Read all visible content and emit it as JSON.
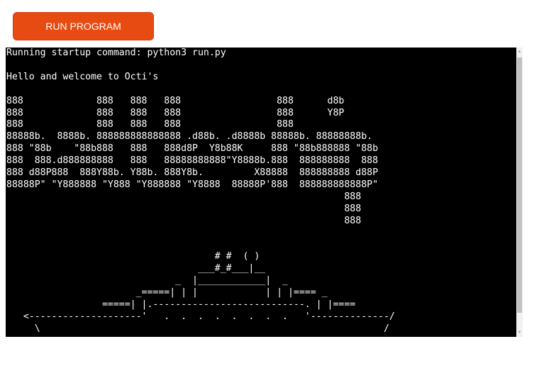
{
  "toolbar": {
    "run_label": "RUN PROGRAM",
    "accent_color": "#e84b12"
  },
  "terminal": {
    "lines": [
      "Running startup command: python3 run.py",
      "",
      "Hello and welcome to Octi's",
      "",
      "888             888   888   888                 888      d8b",
      "888             888   888   888                 888      Y8P",
      "888             888   888   888                 888",
      "88888b.  8888b. 888888888888888 .d88b. .d8888b 88888b. 88888888b.",
      "888 \"88b    \"88b888   888   888d8P  Y8b88K     888 \"88b888888 \"88b",
      "888  888.d888888888   888   88888888888\"Y8888b.888  888888888  888",
      "888 d88P888  888Y88b. Y88b. 888Y8b.         X88888  888888888 d88P",
      "88888P\" \"Y888888 \"Y888 \"Y888888 \"Y8888  88888P'888  888888888888P\"",
      "                                                            888",
      "                                                            888",
      "                                                            888",
      "",
      "",
      "                                     # #  ( )",
      "                                  ___#_#___|__",
      "                              _  |____________|  _",
      "                       _=====| | |            | | |==== _",
      "                 =====| |.---------------------------. | |====",
      "   <--------------------'   .  .  .  .  .  .  .  .   '--------------/",
      "     \\                                                             /"
    ]
  },
  "scrollbar": {
    "up_icon": "triangle-up",
    "down_icon": "triangle-down"
  }
}
